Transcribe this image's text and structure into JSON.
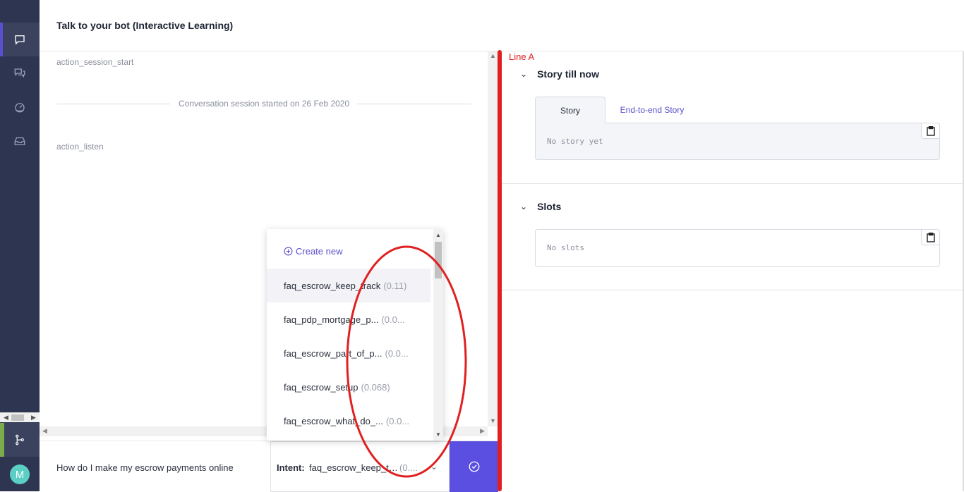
{
  "header": {
    "title": "Talk to your bot (Interactive Learning)"
  },
  "sidebar": {
    "items": [
      {
        "icon": "chat-bubble-icon"
      },
      {
        "icon": "conversations-icon"
      },
      {
        "icon": "dashboard-gauge-icon"
      },
      {
        "icon": "inbox-icon"
      }
    ],
    "git_icon": "git-branch-icon",
    "avatar_initial": "M"
  },
  "chat": {
    "events": [
      "action_session_start",
      "action_listen"
    ],
    "session_separator": "Conversation session started on 26 Feb 2020"
  },
  "input_bar": {
    "user_message": "How do I make my escrow payments online",
    "intent_label": "Intent:",
    "intent_value": "faq_escrow_keep_track",
    "intent_score": "(0....",
    "confirm_icon": "check-circle-icon"
  },
  "dropdown": {
    "create_new": "Create new",
    "options": [
      {
        "name": "faq_escrow_keep_track",
        "score": "(0.11)"
      },
      {
        "name": "faq_pdp_mortgage_p...",
        "score": "(0.0..."
      },
      {
        "name": "faq_escrow_part_of_p...",
        "score": "(0.0..."
      },
      {
        "name": "faq_escrow_setup",
        "score": "(0.068)"
      },
      {
        "name": "faq_escrow_what_do_...",
        "score": "(0.0..."
      }
    ]
  },
  "annotation": {
    "line_label": "Line A",
    "color": "#e02020"
  },
  "right_panel": {
    "story_section": {
      "title": "Story till now",
      "tabs": [
        "Story",
        "End-to-end Story"
      ],
      "content": "No story yet"
    },
    "slots_section": {
      "title": "Slots",
      "content": "No slots"
    }
  },
  "colors": {
    "accent": "#5a4fcf",
    "sidebar": "#2d3550",
    "button": "#5a4fe0"
  }
}
